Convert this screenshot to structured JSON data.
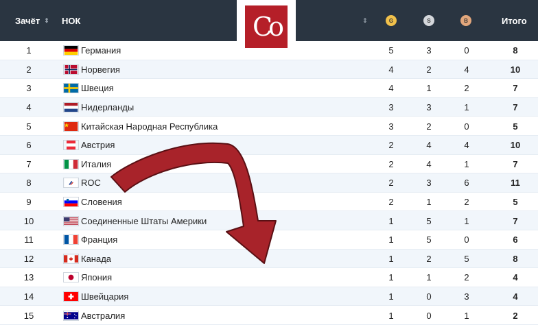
{
  "header": {
    "rank_label": "Зачёт",
    "noc_label": "НОК",
    "sort_icon": "⇕",
    "gold_label": "G",
    "silver_label": "S",
    "bronze_label": "B",
    "total_label": "Итого"
  },
  "logo": {
    "text": "Co"
  },
  "colors": {
    "header_bg": "#2a3541",
    "row_alt": "#f1f6fb",
    "logo": "#b51f28",
    "arrow": "#a8232a"
  },
  "rows": [
    {
      "rank": "1",
      "flag": "germany-flag",
      "name": "Германия",
      "g": "5",
      "s": "3",
      "b": "0",
      "t": "8"
    },
    {
      "rank": "2",
      "flag": "norway-flag",
      "name": "Норвегия",
      "g": "4",
      "s": "2",
      "b": "4",
      "t": "10"
    },
    {
      "rank": "3",
      "flag": "sweden-flag",
      "name": "Швеция",
      "g": "4",
      "s": "1",
      "b": "2",
      "t": "7"
    },
    {
      "rank": "4",
      "flag": "netherlands-flag",
      "name": "Нидерланды",
      "g": "3",
      "s": "3",
      "b": "1",
      "t": "7"
    },
    {
      "rank": "5",
      "flag": "china-flag",
      "name": "Китайская Народная Республика",
      "g": "3",
      "s": "2",
      "b": "0",
      "t": "5"
    },
    {
      "rank": "6",
      "flag": "austria-flag",
      "name": "Австрия",
      "g": "2",
      "s": "4",
      "b": "4",
      "t": "10"
    },
    {
      "rank": "7",
      "flag": "italy-flag",
      "name": "Италия",
      "g": "2",
      "s": "4",
      "b": "1",
      "t": "7"
    },
    {
      "rank": "8",
      "flag": "roc-flag",
      "name": "ROC",
      "g": "2",
      "s": "3",
      "b": "6",
      "t": "11"
    },
    {
      "rank": "9",
      "flag": "slovenia-flag",
      "name": "Словения",
      "g": "2",
      "s": "1",
      "b": "2",
      "t": "5"
    },
    {
      "rank": "10",
      "flag": "usa-flag",
      "name": "Соединенные Штаты Америки",
      "g": "1",
      "s": "5",
      "b": "1",
      "t": "7"
    },
    {
      "rank": "11",
      "flag": "france-flag",
      "name": "Франция",
      "g": "1",
      "s": "5",
      "b": "0",
      "t": "6"
    },
    {
      "rank": "12",
      "flag": "canada-flag",
      "name": "Канада",
      "g": "1",
      "s": "2",
      "b": "5",
      "t": "8"
    },
    {
      "rank": "13",
      "flag": "japan-flag",
      "name": "Япония",
      "g": "1",
      "s": "1",
      "b": "2",
      "t": "4"
    },
    {
      "rank": "14",
      "flag": "switzerland-flag",
      "name": "Швейцария",
      "g": "1",
      "s": "0",
      "b": "3",
      "t": "4"
    },
    {
      "rank": "15",
      "flag": "australia-flag",
      "name": "Австралия",
      "g": "1",
      "s": "0",
      "b": "1",
      "t": "2"
    }
  ]
}
